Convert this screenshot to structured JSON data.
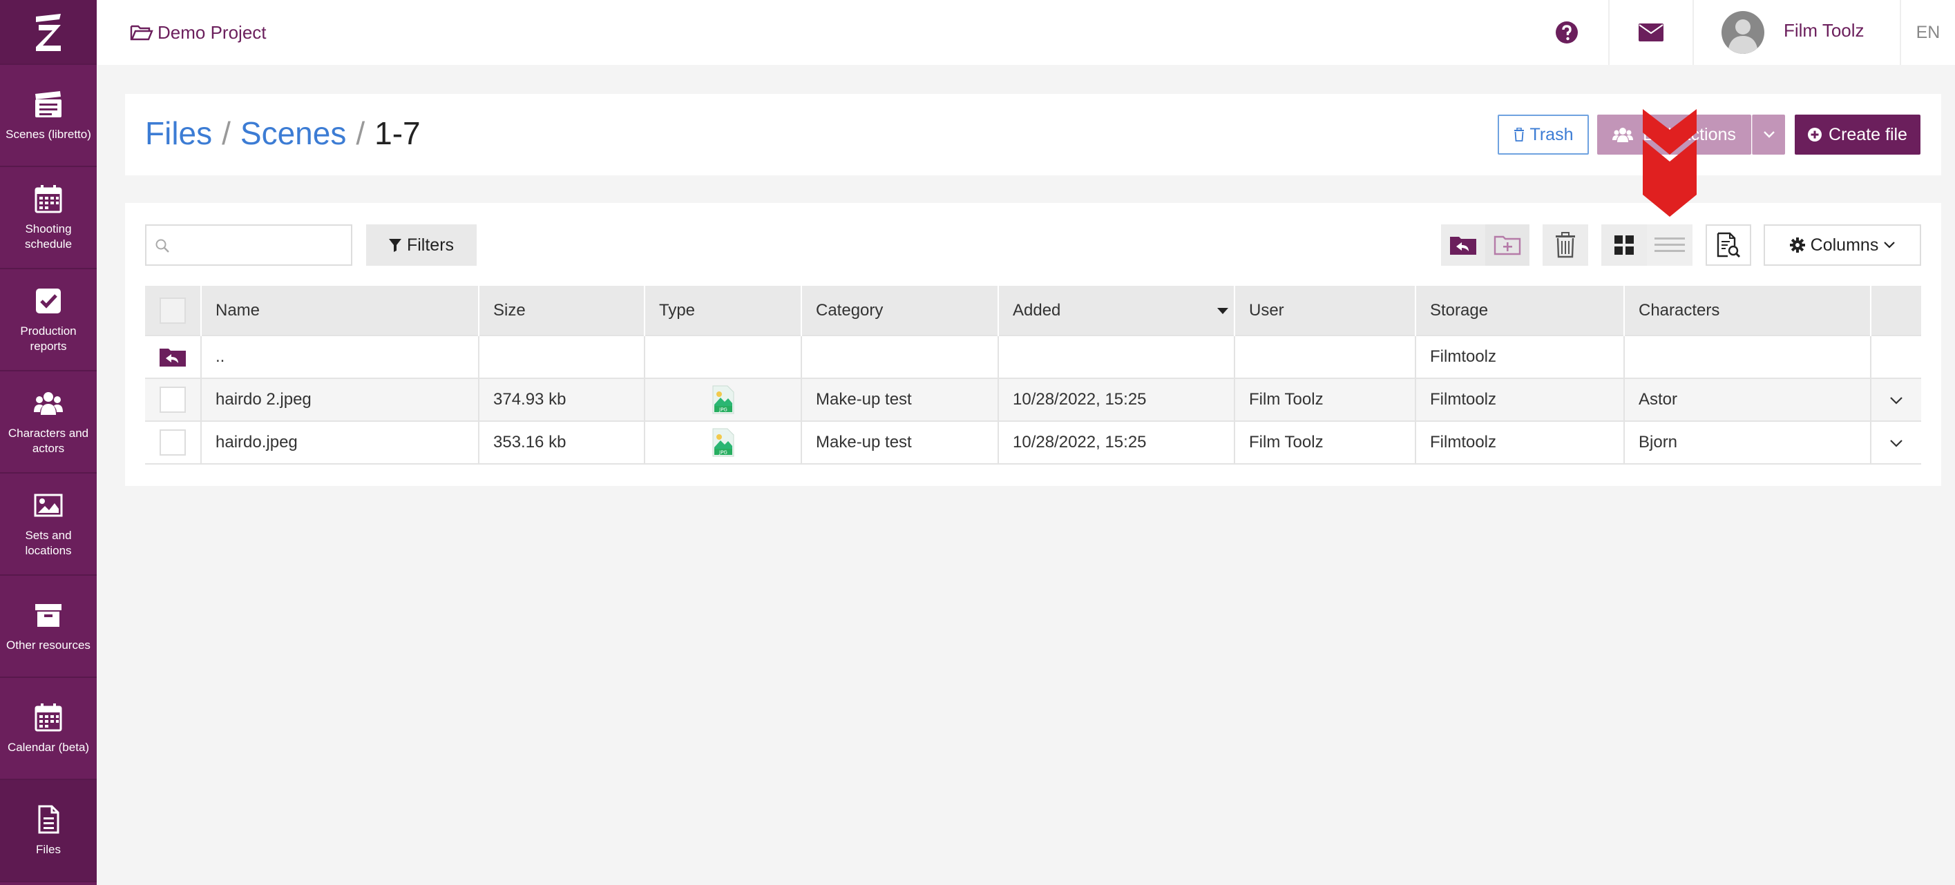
{
  "sidebar": {
    "items": [
      {
        "label": "Scenes (libretto)",
        "icon": "clapperboard-icon"
      },
      {
        "label": "Shooting schedule",
        "icon": "calendar-icon"
      },
      {
        "label": "Production reports",
        "icon": "checkbox-icon"
      },
      {
        "label": "Characters and actors",
        "icon": "users-icon"
      },
      {
        "label": "Sets and locations",
        "icon": "image-icon"
      },
      {
        "label": "Other resources",
        "icon": "archive-icon"
      },
      {
        "label": "Calendar (beta)",
        "icon": "calendar-icon"
      },
      {
        "label": "Files",
        "icon": "file-icon"
      }
    ]
  },
  "topbar": {
    "project": "Demo Project",
    "user_name": "Film Toolz",
    "language": "EN"
  },
  "breadcrumb": {
    "files": "Files",
    "scenes": "Scenes",
    "current": "1-7",
    "separator": "/"
  },
  "actions": {
    "trash": "Trash",
    "bulk": "Bulk actions",
    "create": "Create file"
  },
  "toolbar": {
    "search_placeholder": "",
    "filters": "Filters",
    "columns": "Columns"
  },
  "table": {
    "headers": {
      "name": "Name",
      "size": "Size",
      "type": "Type",
      "category": "Category",
      "added": "Added",
      "user": "User",
      "storage": "Storage",
      "characters": "Characters"
    },
    "up_row": {
      "name": "..",
      "storage": "Filmtoolz"
    },
    "rows": [
      {
        "name": "hairdo 2.jpeg",
        "size": "374.93 kb",
        "type": "JPG",
        "category": "Make-up test",
        "added": "10/28/2022, 15:25",
        "user": "Film Toolz",
        "storage": "Filmtoolz",
        "characters": "Astor"
      },
      {
        "name": "hairdo.jpeg",
        "size": "353.16 kb",
        "type": "JPG",
        "category": "Make-up test",
        "added": "10/28/2022, 15:25",
        "user": "Film Toolz",
        "storage": "Filmtoolz",
        "characters": "Bjorn"
      }
    ]
  },
  "colors": {
    "brand": "#6b1f5c",
    "link": "#3c7cd4",
    "annotation_arrow": "#e02020"
  }
}
